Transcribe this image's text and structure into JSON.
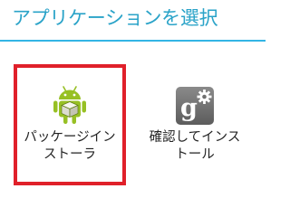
{
  "dialog": {
    "title": "アプリケーションを選択"
  },
  "options": [
    {
      "label": "パッケージイン\nストーラ",
      "icon": "android-package-installer-icon",
      "selected": true
    },
    {
      "label": "確認してインス\nトール",
      "icon": "google-settings-icon",
      "selected": false
    }
  ],
  "colors": {
    "title": "#2aa3c8",
    "divider": "#33b5e5",
    "selection_highlight": "#e0202a",
    "android_green": "#97c024",
    "google_tile": "#707070"
  }
}
